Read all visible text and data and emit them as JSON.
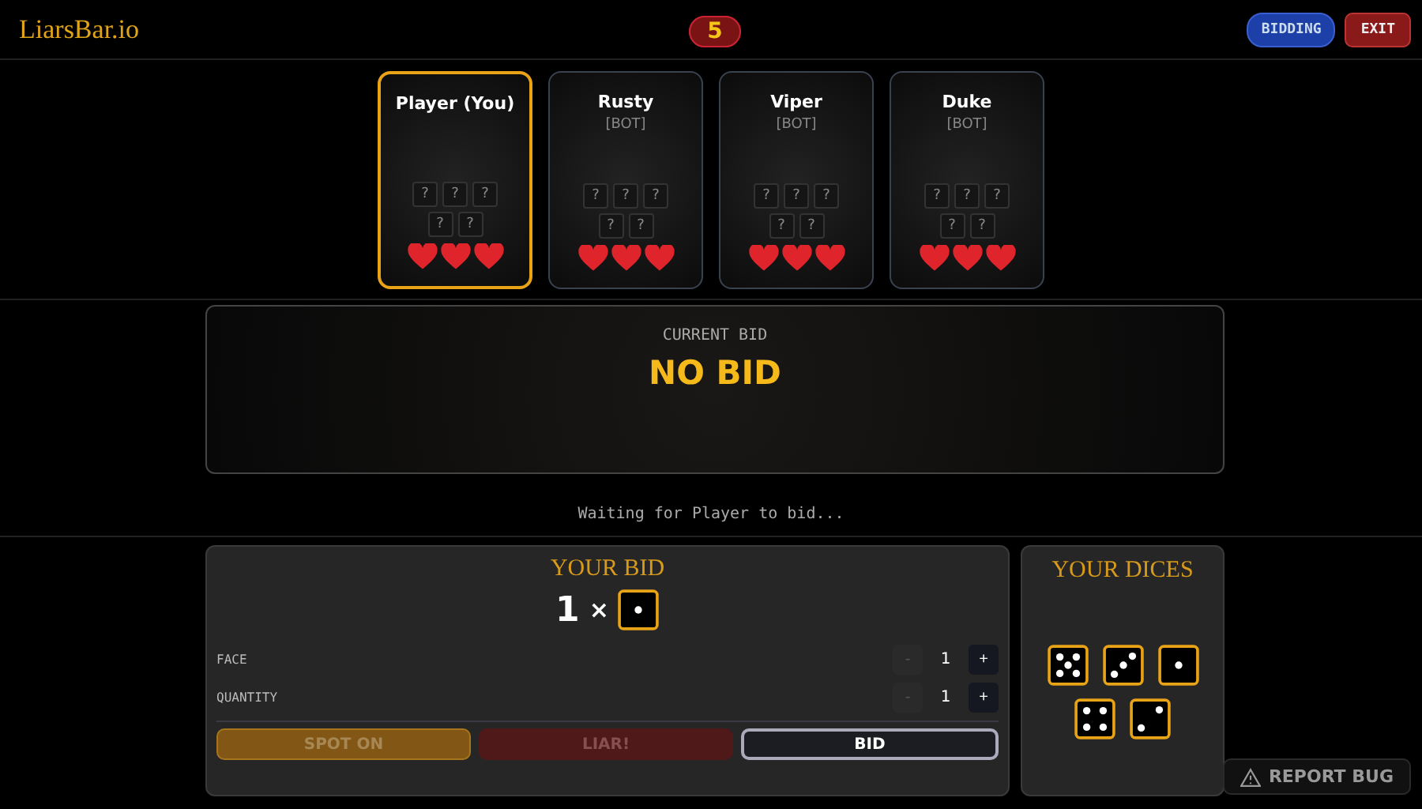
{
  "header": {
    "logo": "LiarsBar.io",
    "round": "5",
    "phase": "BIDDING",
    "exit": "EXIT"
  },
  "players": [
    {
      "name": "Player (You)",
      "selected": true,
      "dice": [
        "?",
        "?",
        "?",
        "?",
        "?"
      ],
      "lives": [
        {
          "lost": false
        },
        {
          "lost": false
        },
        {
          "lost": false
        }
      ]
    },
    {
      "name": "Rusty",
      "tag": "[BOT]",
      "selected": false,
      "dice": [
        "?",
        "?",
        "?",
        "?",
        "?"
      ],
      "lives": [
        {
          "lost": false
        },
        {
          "lost": false
        },
        {
          "lost": false
        }
      ]
    },
    {
      "name": "Viper",
      "tag": "[BOT]",
      "selected": false,
      "dice": [
        "?",
        "?",
        "?",
        "?",
        "?"
      ],
      "lives": [
        {
          "lost": false
        },
        {
          "lost": false
        },
        {
          "lost": false
        }
      ]
    },
    {
      "name": "Duke",
      "tag": "[BOT]",
      "selected": false,
      "dice": [
        "?",
        "?",
        "?",
        "?",
        "?"
      ],
      "lives": [
        {
          "lost": false
        },
        {
          "lost": false
        },
        {
          "lost": false
        }
      ]
    }
  ],
  "current_bid": {
    "label": "CURRENT BID",
    "value": "NO BID"
  },
  "status": "Waiting for Player to bid...",
  "your_bid": {
    "title": "YOUR BID",
    "quantity": "1",
    "times": "×",
    "face": {
      "kind": "one"
    },
    "steppers": [
      {
        "label": "FACE",
        "minus": "-",
        "value": "1",
        "plus": "+",
        "minus_disabled": true
      },
      {
        "label": "QUANTITY",
        "minus": "-",
        "value": "1",
        "plus": "+",
        "minus_disabled": true
      }
    ],
    "actions": [
      {
        "kind": "spot",
        "label": "SPOT ON",
        "disabled": true
      },
      {
        "kind": "liar",
        "label": "LIAR!",
        "disabled": true
      },
      {
        "kind": "bid",
        "label": "BID",
        "disabled": false
      }
    ]
  },
  "your_dice": {
    "title": "YOUR DICES",
    "faces": [
      {
        "kind": "five"
      },
      {
        "kind": "three"
      },
      {
        "kind": "one"
      },
      {
        "kind": "four"
      },
      {
        "kind": "two"
      }
    ]
  },
  "report": {
    "label": "REPORT BUG"
  }
}
